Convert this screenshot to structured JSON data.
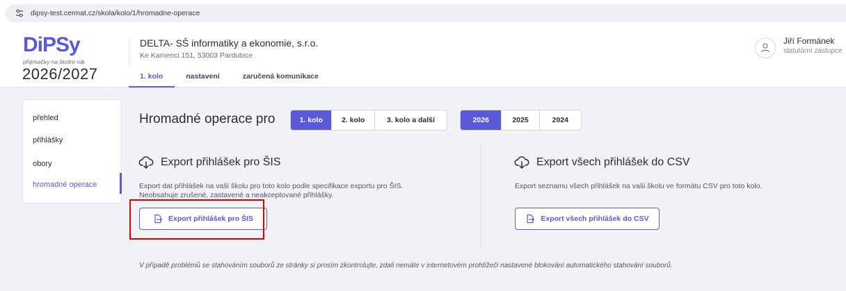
{
  "browser": {
    "url": "dipsy-test.cermat.cz/skola/kolo/1/hromadne-operace"
  },
  "brand": {
    "logo": "DiPSy",
    "subtitle": "přijímačky na školní rok",
    "year": "2026/2027",
    "accent": "#5a59d8"
  },
  "school": {
    "name": "DELTA- SŠ informatiky a ekonomie, s.r.o.",
    "address": "Ke Kamenci 151, 53003 Pardubice"
  },
  "tabs": [
    {
      "label": "1. kolo",
      "active": true
    },
    {
      "label": "nastavení",
      "active": false
    },
    {
      "label": "zaručená komunikace",
      "active": false
    }
  ],
  "user": {
    "name": "Jiří Formánek",
    "role": "statutární zástupce"
  },
  "sidebar": {
    "items": [
      {
        "label": "přehled",
        "active": false
      },
      {
        "label": "přihlášky",
        "active": false
      },
      {
        "label": "obory",
        "active": false
      },
      {
        "label": "hromadné operace",
        "active": true
      }
    ]
  },
  "main": {
    "title": "Hromadné operace pro",
    "rounds": [
      {
        "label": "1. kolo",
        "active": true
      },
      {
        "label": "2. kolo",
        "active": false
      },
      {
        "label": "3. kolo a další",
        "active": false
      }
    ],
    "years": [
      {
        "label": "2026",
        "active": true
      },
      {
        "label": "2025",
        "active": false
      },
      {
        "label": "2024",
        "active": false
      }
    ],
    "sis": {
      "title": "Export přihlášek pro ŠIS",
      "desc_line1": "Export dat přihlášek na vaši školu pro toto kolo podle specifikace exportu pro ŠIS.",
      "desc_line2": "Neobsahuje zrušené, zastavené a neakceptované přihlášky.",
      "button": "Export přihlášek pro ŠIS"
    },
    "csv": {
      "title": "Export všech přihlášek do CSV",
      "desc": "Export seznamu všech přihlášek na vaši školu ve formátu CSV pro toto kolo.",
      "button": "Export všech přihlášek do CSV"
    },
    "note": "V případě problémů se stahováním souborů ze stránky si prosím zkontrolujte, zdali nemáte v internetovém prohlížeči nastavené blokování automatického stahování souborů."
  }
}
